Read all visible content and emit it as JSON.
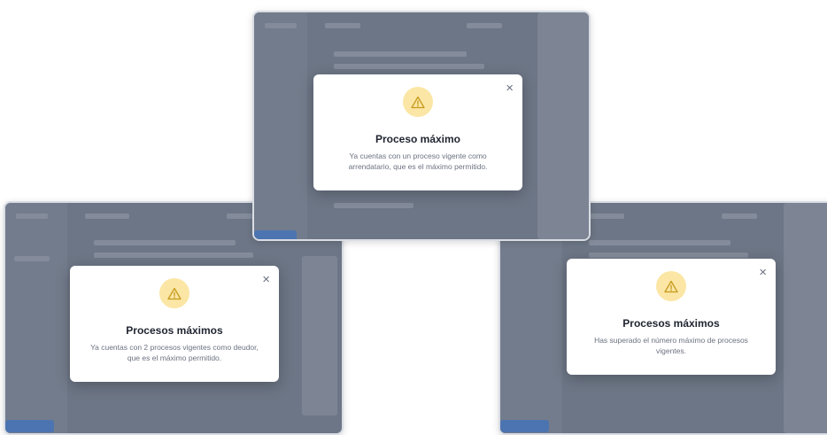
{
  "colors": {
    "overlay": "#6d7686",
    "modal_bg": "#ffffff",
    "warning_bg": "#fbe6a5",
    "warning_icon": "#c79a1b",
    "title": "#1f2430",
    "body_text": "#6b7280"
  },
  "dialogs": [
    {
      "id": "left",
      "icon": "warning-icon",
      "title": "Procesos máximos",
      "message": "Ya cuentas con 2 procesos vigentes como deudor, que es el máximo permitido.",
      "close_label": "×"
    },
    {
      "id": "top",
      "icon": "warning-icon",
      "title": "Proceso máximo",
      "message": "Ya cuentas con un proceso vigente como arrendatario, que es el máximo permitido.",
      "close_label": "×"
    },
    {
      "id": "right",
      "icon": "warning-icon",
      "title": "Procesos máximos",
      "message": "Has superado el número máximo de procesos vigentes.",
      "close_label": "×"
    }
  ]
}
